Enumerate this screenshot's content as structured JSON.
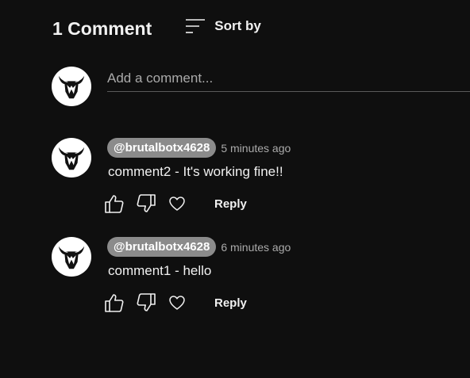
{
  "header": {
    "count_title": "1 Comment",
    "sort_label": "Sort by",
    "sort_icon": "sort-lines-icon"
  },
  "add_comment": {
    "placeholder": "Add a comment...",
    "value": ""
  },
  "comments": [
    {
      "author": "@brutalbotx4628",
      "timestamp": "5 minutes ago",
      "text": "comment2 - It's working fine!!",
      "reply_label": "Reply"
    },
    {
      "author": "@brutalbotx4628",
      "timestamp": "6 minutes ago",
      "text": "comment1 - hello",
      "reply_label": "Reply"
    }
  ],
  "icons": {
    "avatar": "bull-logo-avatar",
    "like": "thumbs-up-icon",
    "dislike": "thumbs-down-icon",
    "heart": "heart-icon"
  },
  "colors": {
    "background": "#0f0f0f",
    "text": "#f1f1f1",
    "secondary_text": "#aaaaaa",
    "author_chip": "#8b8b8b"
  }
}
